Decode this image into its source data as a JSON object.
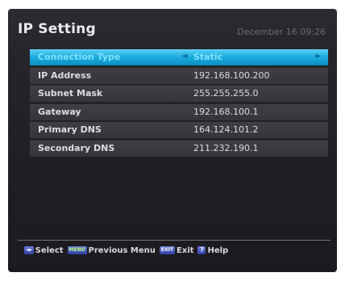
{
  "screen": {
    "title": "IP Setting",
    "datetime": "December 16 09:26"
  },
  "settings": [
    {
      "label": "Connection Type",
      "value": "Static"
    },
    {
      "label": "IP Address",
      "value": "192.168.100.200"
    },
    {
      "label": "Subnet Mask",
      "value": "255.255.255.0"
    },
    {
      "label": "Gateway",
      "value": "192.168.100.1"
    },
    {
      "label": "Primary DNS",
      "value": "164.124.101.2"
    },
    {
      "label": "Secondary DNS",
      "value": "211.232.190.1"
    }
  ],
  "selector_arrows": {
    "left": "◄",
    "right": "►"
  },
  "footer": {
    "select_key": "◄▸",
    "select_label": "Select",
    "menu_key": "MENU",
    "menu_label": "Previous Menu",
    "exit_key": "EXIT",
    "exit_label": "Exit",
    "help_key": "?",
    "help_label": "Help"
  },
  "colors": {
    "selected_row": "#1eaee0",
    "row": "#3a3a40",
    "background": "#222226"
  }
}
